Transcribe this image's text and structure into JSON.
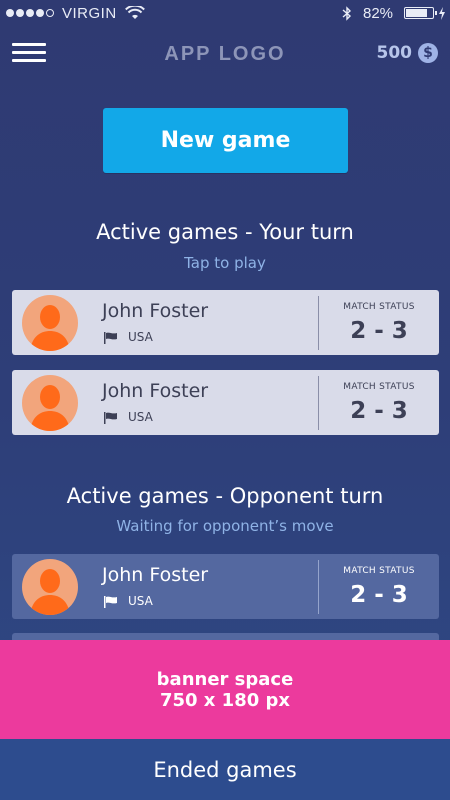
{
  "status_bar": {
    "signal_bars": 4,
    "carrier": "VIRGIN",
    "battery_percent": "82%",
    "battery_level": 0.82
  },
  "header": {
    "logo": "APP LOGO",
    "coins": "500",
    "coin_symbol": "$"
  },
  "new_game_label": "New game",
  "your_turn": {
    "title": "Active games - Your turn",
    "subtitle": "Tap to play",
    "games": [
      {
        "name": "John Foster",
        "country": "USA",
        "status_label": "MATCH STATUS",
        "score": "2 - 3"
      },
      {
        "name": "John Foster",
        "country": "USA",
        "status_label": "MATCH STATUS",
        "score": "2 - 3"
      }
    ]
  },
  "opponent_turn": {
    "title": "Active games - Opponent turn",
    "subtitle": "Waiting for opponent’s move",
    "games": [
      {
        "name": "John Foster",
        "country": "USA",
        "status_label": "MATCH STATUS",
        "score": "2 - 3"
      }
    ]
  },
  "banner": {
    "line1": "banner space",
    "line2": "750 x 180 px"
  },
  "ended_games_label": "Ended games",
  "colors": {
    "primary_button": "#12a8e8",
    "banner": "#ec3a9d",
    "avatar_bg": "#f2a57c",
    "avatar_fg": "#ff6a1a"
  }
}
